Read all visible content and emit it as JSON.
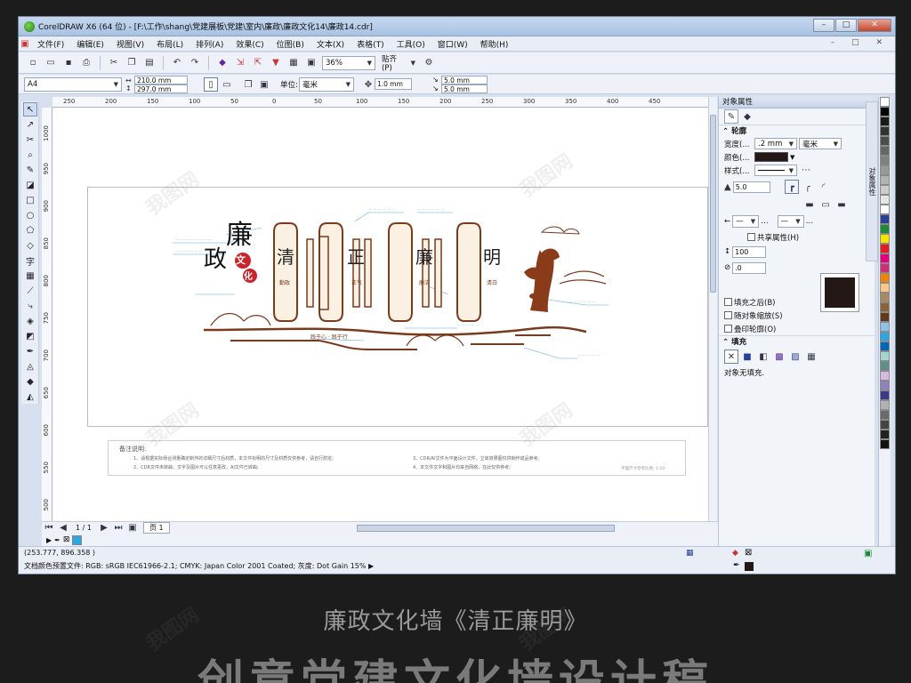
{
  "window": {
    "title": "CorelDRAW X6 (64 位) - [F:\\工作\\shang\\党建展板\\党建\\室内\\廉政\\廉政文化14\\廉政14.cdr]",
    "controls": [
      "–",
      "□",
      "✕"
    ]
  },
  "menu": [
    "文件(F)",
    "编辑(E)",
    "视图(V)",
    "布局(L)",
    "排列(A)",
    "效果(C)",
    "位图(B)",
    "文本(X)",
    "表格(T)",
    "工具(O)",
    "窗口(W)",
    "帮助(H)"
  ],
  "toolbar": {
    "zoom": "36%",
    "snap_label": "贴齐(P)"
  },
  "propbar": {
    "page_size": "A4",
    "width": "210.0 mm",
    "height": "297.0 mm",
    "unit_label": "单位:",
    "unit": "毫米",
    "nudge": "1.0 mm",
    "dup_x": "5.0 mm",
    "dup_y": "5.0 mm"
  },
  "ruler": {
    "h_ticks": [
      "250",
      "200",
      "150",
      "100",
      "50",
      "0",
      "50",
      "100",
      "150",
      "200",
      "250",
      "300",
      "350",
      "400",
      "450"
    ],
    "v_ticks": [
      "1000",
      "950",
      "900",
      "850",
      "800",
      "750",
      "700",
      "650",
      "600",
      "550",
      "500"
    ]
  },
  "artwork": {
    "title_lian": "廉",
    "title_zheng": "政",
    "seal_wen": "文",
    "seal_hua": "化",
    "panels": [
      "清",
      "正",
      "廉",
      "明"
    ],
    "subtitles": [
      "勤政",
      "正气",
      "廉洁",
      "清白"
    ],
    "slogan": "践于心 · 践于行"
  },
  "notes": {
    "heading": "备注说明:",
    "items": [
      "1、请根据实际场合测量确定制作的详细尺寸后材质，本文件标明的尺寸及材质仅供参考，请自行酌定;",
      "2、CDR文件未转曲，文字及图片可以任意更改，AI文件已转曲;",
      "3、CDR/AI文件为平面设计文件，立体效果图仅供制作成品参考;",
      "4、本文件文字和图片均来自网络，在此仅供参考;"
    ],
    "ratio": "平面尺寸参考比例: 1:10"
  },
  "pager": {
    "page_info": "1 / 1",
    "page_tab": "页 1"
  },
  "docker": {
    "title": "对象属性",
    "outline_section": "轮廓",
    "width_label": "宽度(...",
    "width_value": ".2 mm",
    "width_unit": "毫米",
    "color_label": "颜色(...",
    "style_label": "样式(...",
    "miter": "5.0",
    "shared": "共享属性(H)",
    "pct": "100",
    "angle": ".0",
    "check1": "填充之后(B)",
    "check2": "随对象缩放(S)",
    "check3": "叠印轮廓(O)",
    "fill_section": "填充",
    "no_fill": "对象无填充.",
    "side_tab": "对象属性"
  },
  "status": {
    "coords": "(253.777, 896.358 )",
    "color_profile": "文档颜色预置文件: RGB: sRGB IEC61966-2.1; CMYK: Japan Color 2001 Coated; 灰度: Dot Gain 15% ▶"
  },
  "caption": "廉政文化墙《清正廉明》",
  "big_caption": "创意党建文化墙设计稿",
  "watermark": "我图网",
  "colors": {
    "palette": [
      "#ffffff",
      "#000000",
      "#1a1a1a",
      "#333333",
      "#4d4d4d",
      "#666666",
      "#808080",
      "#999999",
      "#b3b3b3",
      "#cccccc",
      "#e6e6e6",
      "#ffffff",
      "#2b3f99",
      "#1d8a3a",
      "#f5e600",
      "#e11d25",
      "#e4007f",
      "#cf2d7c",
      "#f08300",
      "#fdc689",
      "#a68a64",
      "#8c6239",
      "#5f3b1c",
      "#8dc3e6",
      "#2ea7e0",
      "#0068b7",
      "#a3d6cf",
      "#5e8d8a",
      "#d7b9e0",
      "#8e82bc",
      "#3a3a8f",
      "#b2b2b2",
      "#6b6b6b",
      "#444444",
      "#222222",
      "#111111"
    ]
  }
}
